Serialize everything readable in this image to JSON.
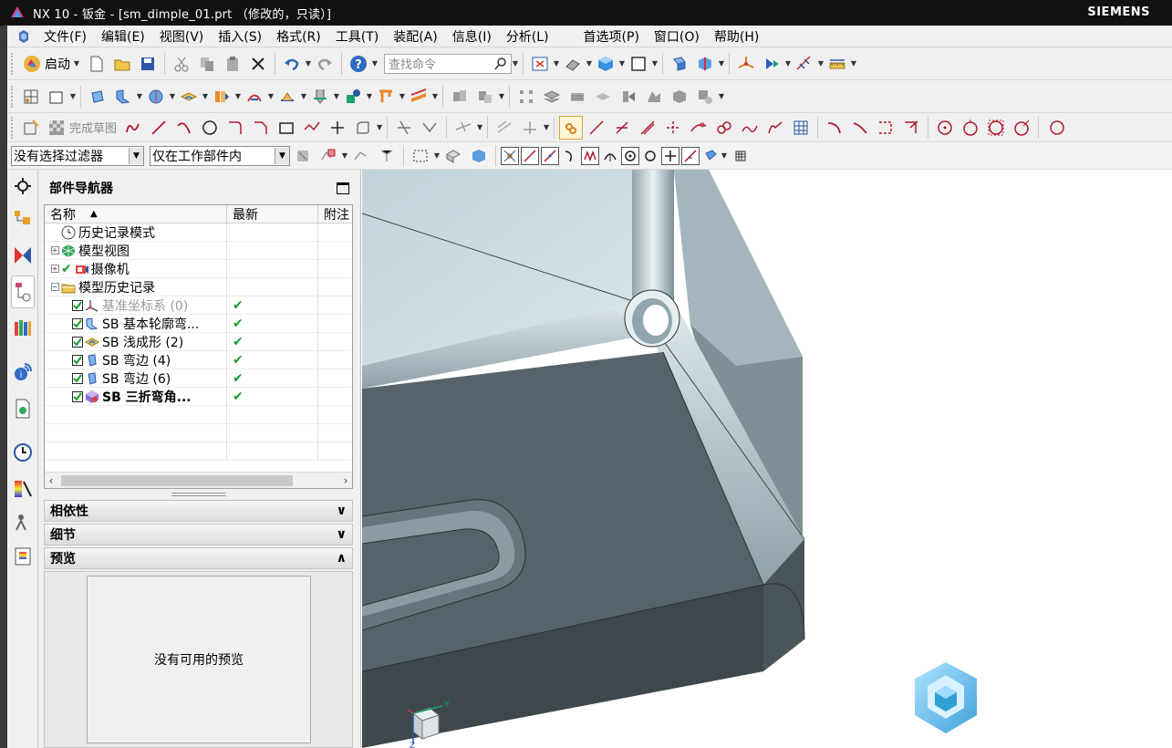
{
  "window": {
    "title": "NX 10 - 钣金 - [sm_dimple_01.prt （修改的，只读）]",
    "brand": "SIEMENS"
  },
  "menu": {
    "items": [
      "文件(F)",
      "编辑(E)",
      "视图(V)",
      "插入(S)",
      "格式(R)",
      "工具(T)",
      "装配(A)",
      "信息(I)",
      "分析(L)"
    ],
    "right_items": [
      "首选项(P)",
      "窗口(O)",
      "帮助(H)"
    ]
  },
  "toolbar": {
    "start_label": "启动",
    "search_placeholder": "查找命令",
    "finish_sketch_label": "完成草图"
  },
  "selection_bar": {
    "filter_value": "没有选择过滤器",
    "scope_value": "仅在工作部件内"
  },
  "navigator": {
    "title": "部件导航器",
    "columns": [
      "名称",
      "最新",
      "附注"
    ],
    "rows": [
      {
        "label": "历史记录模式",
        "latest": "",
        "level": 0,
        "expander": "",
        "check": false,
        "icon": "clock-icon",
        "grey": false
      },
      {
        "label": "模型视图",
        "latest": "",
        "level": 0,
        "expander": "+",
        "check": false,
        "icon": "model-views-icon",
        "grey": false
      },
      {
        "label": "摄像机",
        "latest": "",
        "level": 0,
        "expander": "+",
        "check": true,
        "icon": "camera-icon",
        "grey": false
      },
      {
        "label": "模型历史记录",
        "latest": "",
        "level": 0,
        "expander": "-",
        "check": false,
        "icon": "folder-icon",
        "grey": false
      },
      {
        "label": "基准坐标系 (0)",
        "latest": "✔",
        "level": 1,
        "expander": "",
        "check": true,
        "icon": "datum-csys-icon",
        "grey": true
      },
      {
        "label": "SB 基本轮廓弯...",
        "latest": "✔",
        "level": 1,
        "expander": "",
        "check": true,
        "icon": "contour-flange-icon",
        "grey": false
      },
      {
        "label": "SB 浅成形 (2)",
        "latest": "✔",
        "level": 1,
        "expander": "",
        "check": true,
        "icon": "dimple-icon",
        "grey": false
      },
      {
        "label": "SB 弯边 (4)",
        "latest": "✔",
        "level": 1,
        "expander": "",
        "check": true,
        "icon": "flange-icon",
        "grey": false
      },
      {
        "label": "SB 弯边 (6)",
        "latest": "✔",
        "level": 1,
        "expander": "",
        "check": true,
        "icon": "flange-icon",
        "grey": false
      },
      {
        "label": "SB 三折弯角...",
        "latest": "✔",
        "level": 1,
        "expander": "",
        "check": true,
        "icon": "corner-icon",
        "grey": false,
        "bold": true
      }
    ],
    "panels": {
      "dependencies": "相依性",
      "details": "细节",
      "preview": "预览"
    },
    "preview_empty": "没有可用的预览"
  },
  "viewport": {
    "triad_labels": {
      "y": "Y",
      "z": "Z"
    },
    "colors": {
      "top_face": "#c9d9de",
      "inner_face": "#56636a",
      "side_face": "#4a5559",
      "accent": "#2f9fd6"
    }
  }
}
